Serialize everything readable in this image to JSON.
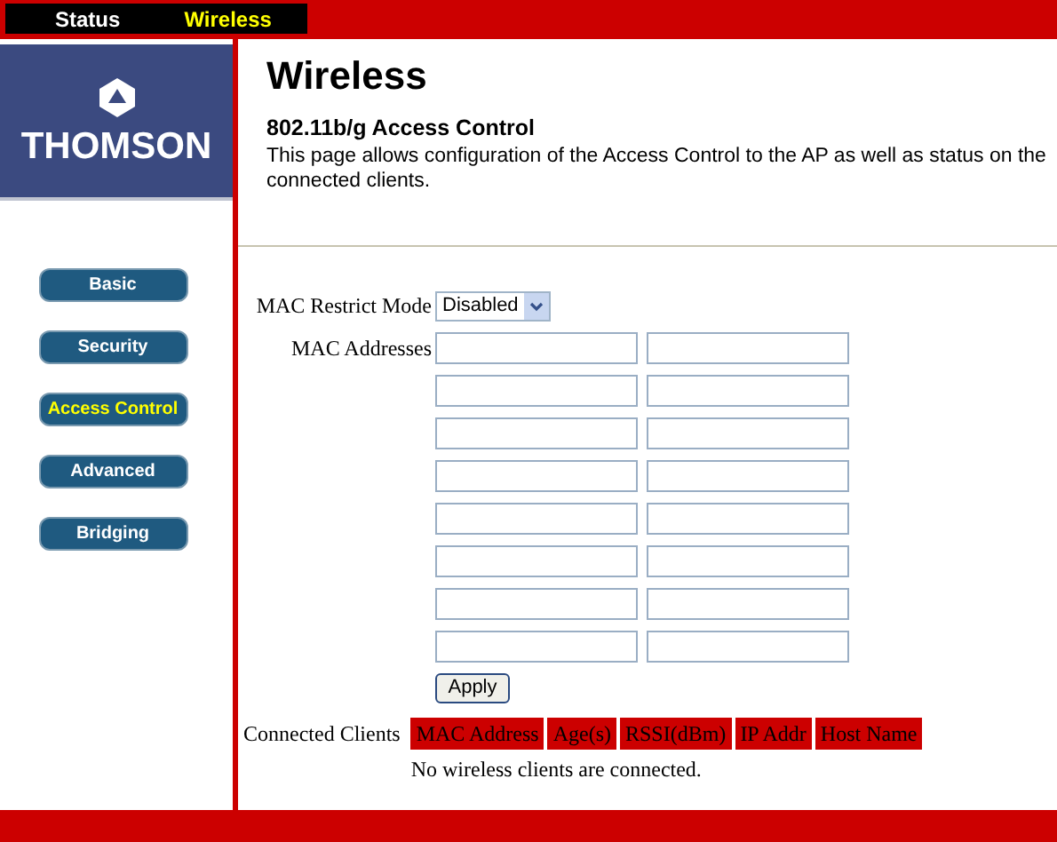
{
  "top_tabs": [
    {
      "label": "Status",
      "selected": false
    },
    {
      "label": "Wireless",
      "selected": true
    }
  ],
  "logo": {
    "text": "THOMSON"
  },
  "sidebar": {
    "items": [
      {
        "label": "Basic",
        "selected": false
      },
      {
        "label": "Security",
        "selected": false
      },
      {
        "label": "Access Control",
        "selected": true
      },
      {
        "label": "Advanced",
        "selected": false
      },
      {
        "label": "Bridging",
        "selected": false
      }
    ]
  },
  "page": {
    "title": "Wireless",
    "subtitle": "802.11b/g Access Control",
    "description": "This page allows configuration of the Access Control to the AP as well as status on the connected clients."
  },
  "form": {
    "restrict_mode": {
      "label": "MAC Restrict Mode",
      "value": "Disabled"
    },
    "mac_addresses": {
      "label": "MAC Addresses",
      "rows": [
        {
          "fields": [
            {
              "kind": "input"
            },
            {
              "kind": "input"
            }
          ]
        },
        {
          "fields": [
            {
              "kind": "input"
            },
            {
              "kind": "input"
            }
          ]
        },
        {
          "fields": [
            {
              "kind": "input"
            },
            {
              "kind": "input"
            }
          ]
        },
        {
          "fields": [
            {
              "kind": "input"
            },
            {
              "kind": "input"
            }
          ]
        },
        {
          "fields": [
            {
              "kind": "input"
            },
            {
              "kind": "input"
            }
          ]
        },
        {
          "fields": [
            {
              "kind": "input"
            },
            {
              "kind": "input"
            }
          ]
        },
        {
          "fields": [
            {
              "kind": "input"
            },
            {
              "kind": "input"
            }
          ]
        },
        {
          "fields": [
            {
              "kind": "input"
            },
            {
              "kind": "input"
            }
          ]
        }
      ]
    },
    "apply_button": "Apply"
  },
  "clients": {
    "label": "Connected Clients",
    "columns": [
      "MAC Address",
      "Age(s)",
      "RSSI(dBm)",
      "IP Addr",
      "Host Name"
    ],
    "empty_message": "No wireless clients are connected."
  }
}
